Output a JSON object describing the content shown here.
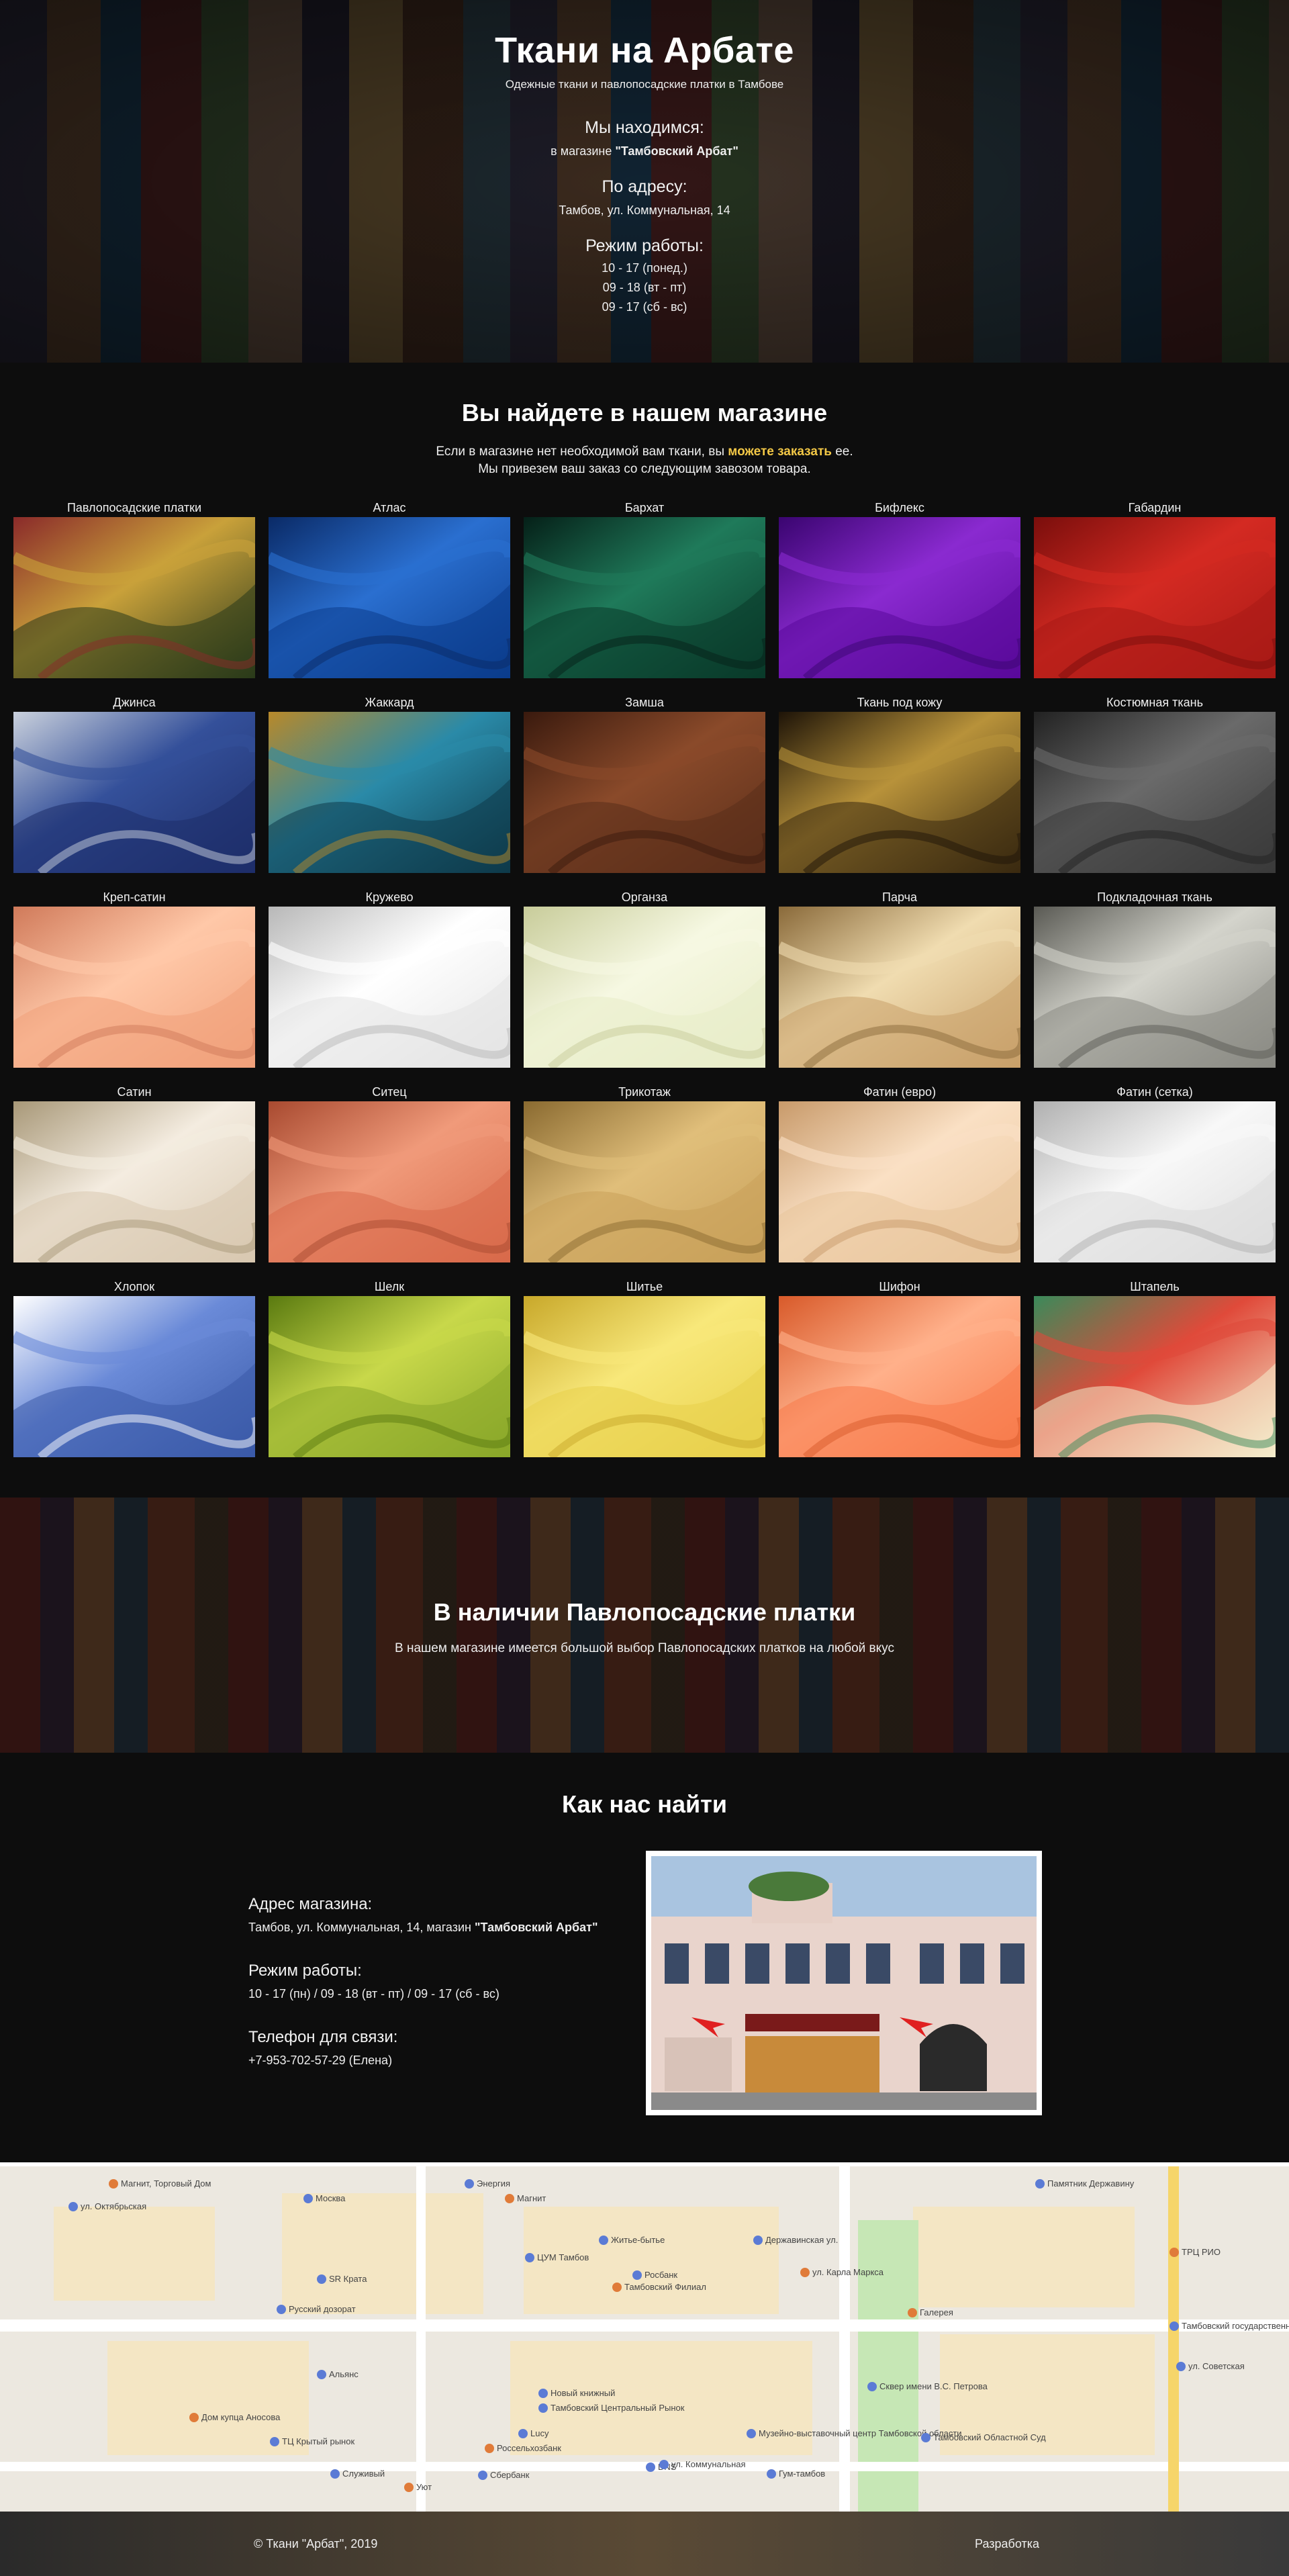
{
  "header": {
    "title": "Ткани на Арбате",
    "subtitle": "Одежные ткани и павлопосадские платки в Тамбове",
    "location_heading": "Мы находимся:",
    "location_prefix": "в магазине ",
    "location_store": "\"Тамбовский Арбат\"",
    "address_heading": "По адресу:",
    "address": "Тамбов, ул. Коммунальная, 14",
    "hours_heading": "Режим работы:",
    "hours": [
      "10 - 17 (понед.)",
      "09 - 18 (вт - пт)",
      "09 - 17 (сб - вс)"
    ]
  },
  "fabrics": {
    "title": "Вы найдете в нашем магазине",
    "lead_part1": "Если в магазине нет необходимой вам ткани, вы ",
    "lead_accent": "можете заказать",
    "lead_part2": " ее.",
    "lead_line2": "Мы привезем ваш заказ со следующим завозом товара.",
    "items": [
      {
        "name": "Павлопосадские платки",
        "colors": [
          "#2a3a1a",
          "#c9a13a",
          "#8a2a2a"
        ]
      },
      {
        "name": "Атлас",
        "colors": [
          "#0b3c8c",
          "#2a6fd0",
          "#0a2a66"
        ]
      },
      {
        "name": "Бархат",
        "colors": [
          "#0a3a2a",
          "#1f7a5a",
          "#052018"
        ]
      },
      {
        "name": "Бифлекс",
        "colors": [
          "#5a0a9a",
          "#8a2ad0",
          "#3a0570"
        ]
      },
      {
        "name": "Габардин",
        "colors": [
          "#a81a16",
          "#d42a22",
          "#7a0e0c"
        ]
      },
      {
        "name": "Джинса",
        "colors": [
          "#1e2e6a",
          "#34509a",
          "#c9d0dc"
        ]
      },
      {
        "name": "Жаккард",
        "colors": [
          "#0e3a4a",
          "#2a8aa8",
          "#b8892a"
        ]
      },
      {
        "name": "Замша",
        "colors": [
          "#5a2e1a",
          "#8a4a2a",
          "#3a1a0e"
        ]
      },
      {
        "name": "Ткань под кожу",
        "colors": [
          "#3a2a10",
          "#b8923a",
          "#1e1408"
        ]
      },
      {
        "name": "Костюмная ткань",
        "colors": [
          "#3a3a3a",
          "#6a6a6a",
          "#222222"
        ]
      },
      {
        "name": "Креп-сатин",
        "colors": [
          "#f0a07a",
          "#ffc8a8",
          "#d07a5a"
        ]
      },
      {
        "name": "Кружево",
        "colors": [
          "#e4e4e4",
          "#ffffff",
          "#b8b8b8"
        ]
      },
      {
        "name": "Органза",
        "colors": [
          "#e8ecc8",
          "#f6f8e2",
          "#c8cc9a"
        ]
      },
      {
        "name": "Парча",
        "colors": [
          "#c8a06a",
          "#f0dcb0",
          "#8a6a3a"
        ]
      },
      {
        "name": "Подкладочная ткань",
        "colors": [
          "#8a8a84",
          "#d4d4cc",
          "#5a5a54"
        ]
      },
      {
        "name": "Сатин",
        "colors": [
          "#d8c8b0",
          "#f4ece0",
          "#a89878"
        ]
      },
      {
        "name": "Ситец",
        "colors": [
          "#d86a4a",
          "#f09a7a",
          "#a84a30"
        ]
      },
      {
        "name": "Трикотаж",
        "colors": [
          "#c8a05a",
          "#e0be7a",
          "#8a6a30"
        ]
      },
      {
        "name": "Фатин (евро)",
        "colors": [
          "#e8c49a",
          "#fae0c4",
          "#c89a6a"
        ]
      },
      {
        "name": "Фатин (сетка)",
        "colors": [
          "#dcdcdc",
          "#f8f8f8",
          "#b0b0b0"
        ]
      },
      {
        "name": "Хлопок",
        "colors": [
          "#3a5aa8",
          "#6a8ad8",
          "#ffffff"
        ]
      },
      {
        "name": "Шелк",
        "colors": [
          "#8aa82a",
          "#c8d84a",
          "#5a7a10"
        ]
      },
      {
        "name": "Шитье",
        "colors": [
          "#e8d04a",
          "#f8e87a",
          "#c8a82a"
        ]
      },
      {
        "name": "Шифон",
        "colors": [
          "#f87a4a",
          "#ffb08a",
          "#d85a2a"
        ]
      },
      {
        "name": "Штапель",
        "colors": [
          "#f4eccc",
          "#e04a3a",
          "#3a8a5a"
        ]
      }
    ]
  },
  "shawls": {
    "title": "В наличии Павлопосадские платки",
    "text": "В нашем магазине имеется большой выбор Павлопосадских платков на любой вкус"
  },
  "findus": {
    "title": "Как нас найти",
    "address_label": "Адрес магазина:",
    "address_prefix": "Тамбов, ул. Коммунальная, 14, магазин ",
    "address_store": "\"Тамбовский Арбат\"",
    "hours_label": "Режим работы:",
    "hours": "10 - 17 (пн) / 09 - 18 (вт - пт) / 09 - 17 (сб - вс)",
    "phone_label": "Телефон для связи:",
    "phone": "+7-953-702-57-29 (Елена)"
  },
  "map": {
    "labels": [
      "Магнит, Торговый Дом",
      "ул. Октябрьская",
      "Москва",
      "Энергия",
      "Магнит",
      "Житье-бытье",
      "ЦУМ Тамбов",
      "Росбанк",
      "Тамбовский Филиал",
      "SR Крата",
      "Русский дозорат",
      "Альянс",
      "Дом купца Аносова",
      "ТЦ Крытый рынок",
      "Служивый",
      "Сбербанк",
      "Уют",
      "Новый книжный",
      "Тамбовский Центральный Рынок",
      "Lucy",
      "Россельхозбанк",
      "Музейно-выставочный центр Тамбовской области",
      "DNS",
      "Гум-тамбов",
      "Галерея",
      "Сквер имени В.С. Петрова",
      "Тамбовский Областной Суд",
      "Памятник Державину",
      "ТРЦ РИО",
      "Тамбовский государственный университет им. Г. Р. Державина",
      "ул. Коммунальная",
      "ул. Советская",
      "ул. Карла Маркса",
      "Державинская ул."
    ]
  },
  "footer": {
    "copyright": "© Ткани \"Арбат\", 2019",
    "developer": "Разработка"
  },
  "colors": {
    "accent": "#f3c846",
    "background": "#0d0d0d"
  }
}
